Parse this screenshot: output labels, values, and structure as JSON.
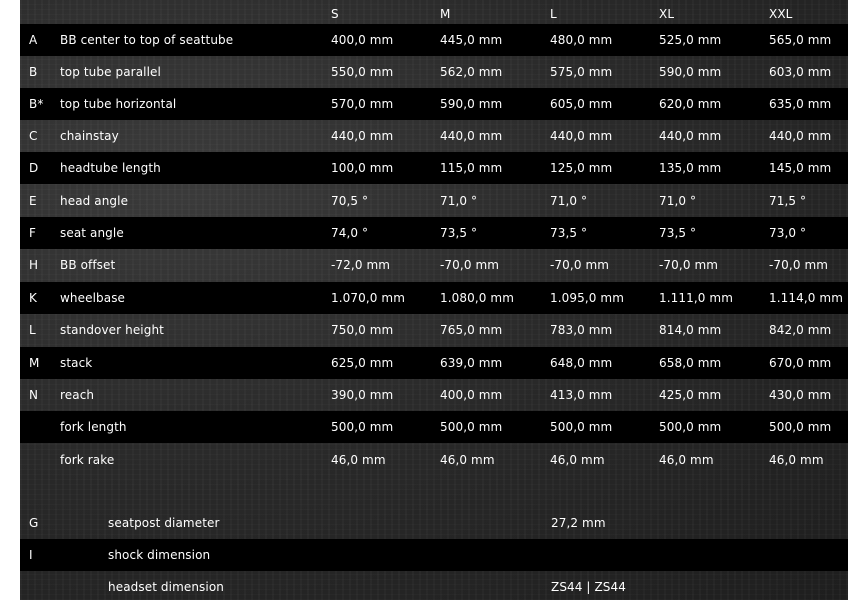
{
  "sizes": [
    "S",
    "M",
    "L",
    "XL",
    "XXL"
  ],
  "rows": [
    {
      "letter": "A",
      "label": "BB center to top of seattube",
      "values": [
        "400,0 mm",
        "445,0 mm",
        "480,0 mm",
        "525,0 mm",
        "565,0 mm"
      ]
    },
    {
      "letter": "B",
      "label": "top tube parallel",
      "values": [
        "550,0 mm",
        "562,0 mm",
        "575,0 mm",
        "590,0 mm",
        "603,0 mm"
      ]
    },
    {
      "letter": "B*",
      "label": "top tube horizontal",
      "values": [
        "570,0 mm",
        "590,0 mm",
        "605,0 mm",
        "620,0 mm",
        "635,0 mm"
      ]
    },
    {
      "letter": "C",
      "label": "chainstay",
      "values": [
        "440,0 mm",
        "440,0 mm",
        "440,0 mm",
        "440,0 mm",
        "440,0 mm"
      ]
    },
    {
      "letter": "D",
      "label": "headtube length",
      "values": [
        "100,0 mm",
        "115,0 mm",
        "125,0 mm",
        "135,0 mm",
        "145,0 mm"
      ]
    },
    {
      "letter": "E",
      "label": "head angle",
      "values": [
        "70,5 °",
        "71,0 °",
        "71,0 °",
        "71,0 °",
        "71,5 °"
      ]
    },
    {
      "letter": "F",
      "label": "seat angle",
      "values": [
        "74,0 °",
        "73,5 °",
        "73,5 °",
        "73,5 °",
        "73,0 °"
      ]
    },
    {
      "letter": "H",
      "label": "BB offset",
      "values": [
        "-72,0 mm",
        "-70,0 mm",
        "-70,0 mm",
        "-70,0 mm",
        "-70,0 mm"
      ]
    },
    {
      "letter": "K",
      "label": "wheelbase",
      "values": [
        "1.070,0 mm",
        "1.080,0 mm",
        "1.095,0 mm",
        "1.111,0 mm",
        "1.114,0 mm"
      ]
    },
    {
      "letter": "L",
      "label": "standover height",
      "values": [
        "750,0 mm",
        "765,0 mm",
        "783,0 mm",
        "814,0 mm",
        "842,0 mm"
      ]
    },
    {
      "letter": "M",
      "label": "stack",
      "values": [
        "625,0 mm",
        "639,0 mm",
        "648,0 mm",
        "658,0 mm",
        "670,0 mm"
      ]
    },
    {
      "letter": "N",
      "label": "reach",
      "values": [
        "390,0 mm",
        "400,0 mm",
        "413,0 mm",
        "425,0 mm",
        "430,0 mm"
      ]
    },
    {
      "letter": "",
      "label": "fork length",
      "values": [
        "500,0 mm",
        "500,0 mm",
        "500,0 mm",
        "500,0 mm",
        "500,0 mm"
      ]
    },
    {
      "letter": "",
      "label": "fork rake",
      "values": [
        "46,0 mm",
        "46,0 mm",
        "46,0 mm",
        "46,0 mm",
        "46,0 mm"
      ]
    }
  ],
  "specs": [
    {
      "letter": "G",
      "label": "seatpost diameter",
      "value": "27,2 mm"
    },
    {
      "letter": "I",
      "label": "shock dimension",
      "value": ""
    },
    {
      "letter": "",
      "label": "headset dimension",
      "value": "ZS44 | ZS44"
    }
  ]
}
